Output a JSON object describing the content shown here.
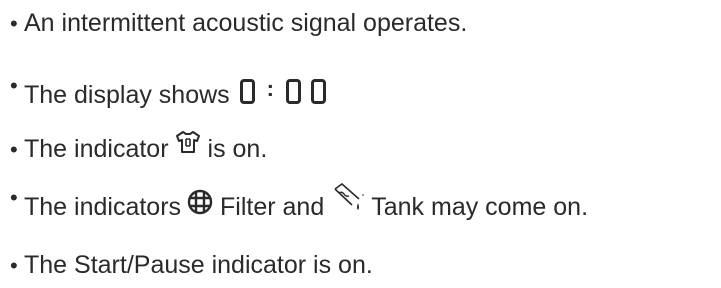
{
  "bullets": [
    {
      "text": "An intermittent acoustic signal operates."
    },
    {
      "text": "The display shows"
    },
    {
      "text_before": "The indicator",
      "text_after": "is on."
    },
    {
      "text_before": "The indicators",
      "filter_label": "Filter and",
      "tank_label": "Tank may come on."
    },
    {
      "text": "The Start/Pause indicator is on."
    }
  ],
  "display": {
    "d1": "0",
    "separator": ":",
    "d2": "0",
    "d3": "0"
  },
  "icons": {
    "shirt": "shirt-indicator-icon",
    "filter": "filter-indicator-icon",
    "tank": "tank-indicator-icon"
  }
}
